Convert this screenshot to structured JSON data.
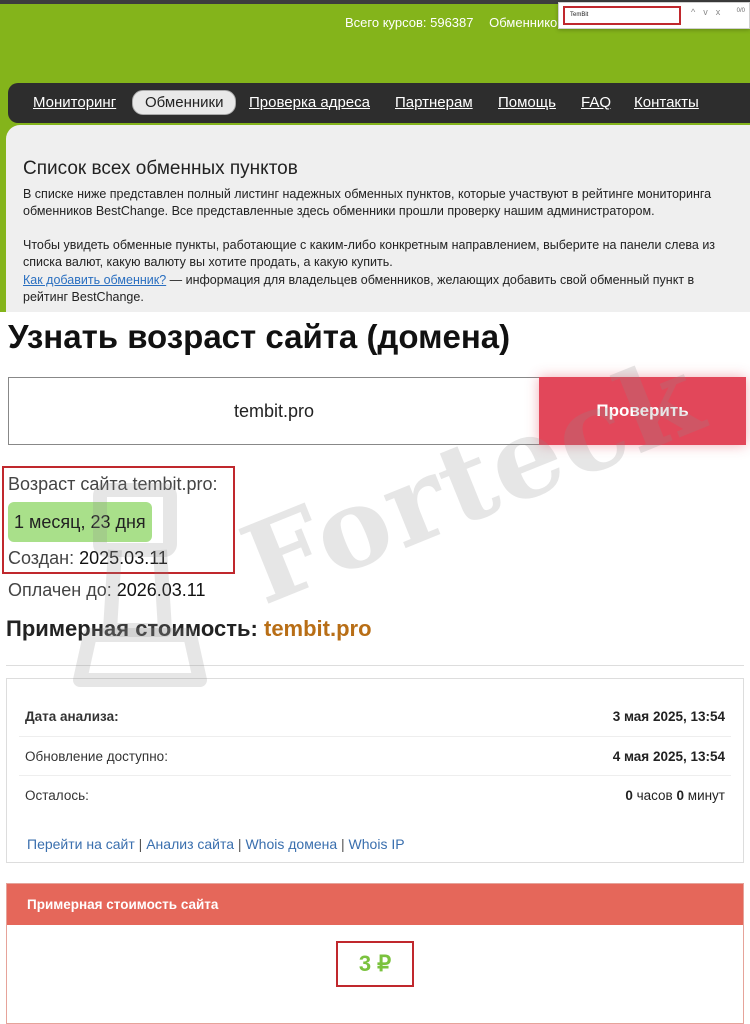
{
  "header": {
    "stats": [
      "Всего курсов: 596387",
      "Обменнико"
    ],
    "find_bar": {
      "query": "TemBit",
      "count": "0/0",
      "buttons": [
        "^",
        "v",
        "x"
      ]
    }
  },
  "nav": {
    "items": [
      {
        "label": "Мониторинг",
        "active": false
      },
      {
        "label": "Обменники",
        "active": true
      },
      {
        "label": "Проверка адреса",
        "active": false
      },
      {
        "label": "Партнерам",
        "active": false
      },
      {
        "label": "Помощь",
        "active": false
      },
      {
        "label": "FAQ",
        "active": false
      },
      {
        "label": "Контакты",
        "active": false
      }
    ]
  },
  "exchangers": {
    "title": "Список всех обменных пунктов",
    "p1": "В списке ниже представлен полный листинг надежных обменных пунктов, которые участвуют в рейтинге мониторинга обменников BestChange. Все представленные здесь обменники прошли проверку нашим администратором.",
    "p2": "Чтобы увидеть обменные пункты, работающие с каким-либо конкретным направлением, выберите на панели слева из списка валют, какую валюту вы хотите продать, а какую купить.",
    "p3_link": "Как добавить обменник?",
    "p3_rest": " — информация для владельцев обменников, желающих добавить свой обменный пункт в рейтинг BestChange."
  },
  "domain_age": {
    "title": "Узнать возраст сайта (домена)",
    "input_value": "tembit.pro",
    "check_button": "Проверить",
    "age_label": "Возраст сайта tembit.pro:",
    "age_value": "1 месяц, 23 дня",
    "created_label": "Создан:",
    "created_value": "2025.03.11",
    "paid_label": "Оплачен до:",
    "paid_value": "2026.03.11"
  },
  "cost": {
    "title_prefix": "Примерная стоимость:",
    "title_domain": "tembit.pro",
    "rows": [
      {
        "label": "Дата анализа:",
        "value": "3 мая 2025, 13:54"
      },
      {
        "label": "Обновление доступно:",
        "value": "4 мая 2025, 13:54"
      }
    ],
    "remaining": {
      "label": "Осталось:",
      "hours": "0",
      "hours_unit": "часов",
      "minutes": "0",
      "minutes_unit": "минут"
    },
    "links": [
      "Перейти на сайт",
      "Анализ сайта",
      "Whois домена",
      "Whois IP"
    ],
    "box_title": "Примерная стоимость сайта",
    "box_value": "3 ₽"
  },
  "watermark": "Forteck",
  "colors": {
    "header_green": "#84b41b",
    "nav_dark": "#2d2d2d",
    "button_red": "#e2475a",
    "age_green": "#a9e08a",
    "domain_orange": "#b86e16",
    "cost_head": "#e5675a",
    "highlight_red": "#c0282d"
  }
}
